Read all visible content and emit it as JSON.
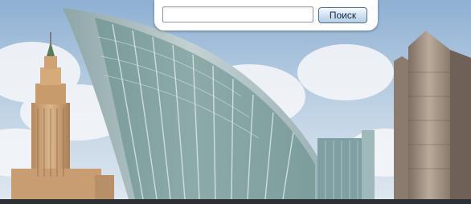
{
  "search": {
    "placeholder": "",
    "value": "",
    "button_label": "Поиск"
  }
}
